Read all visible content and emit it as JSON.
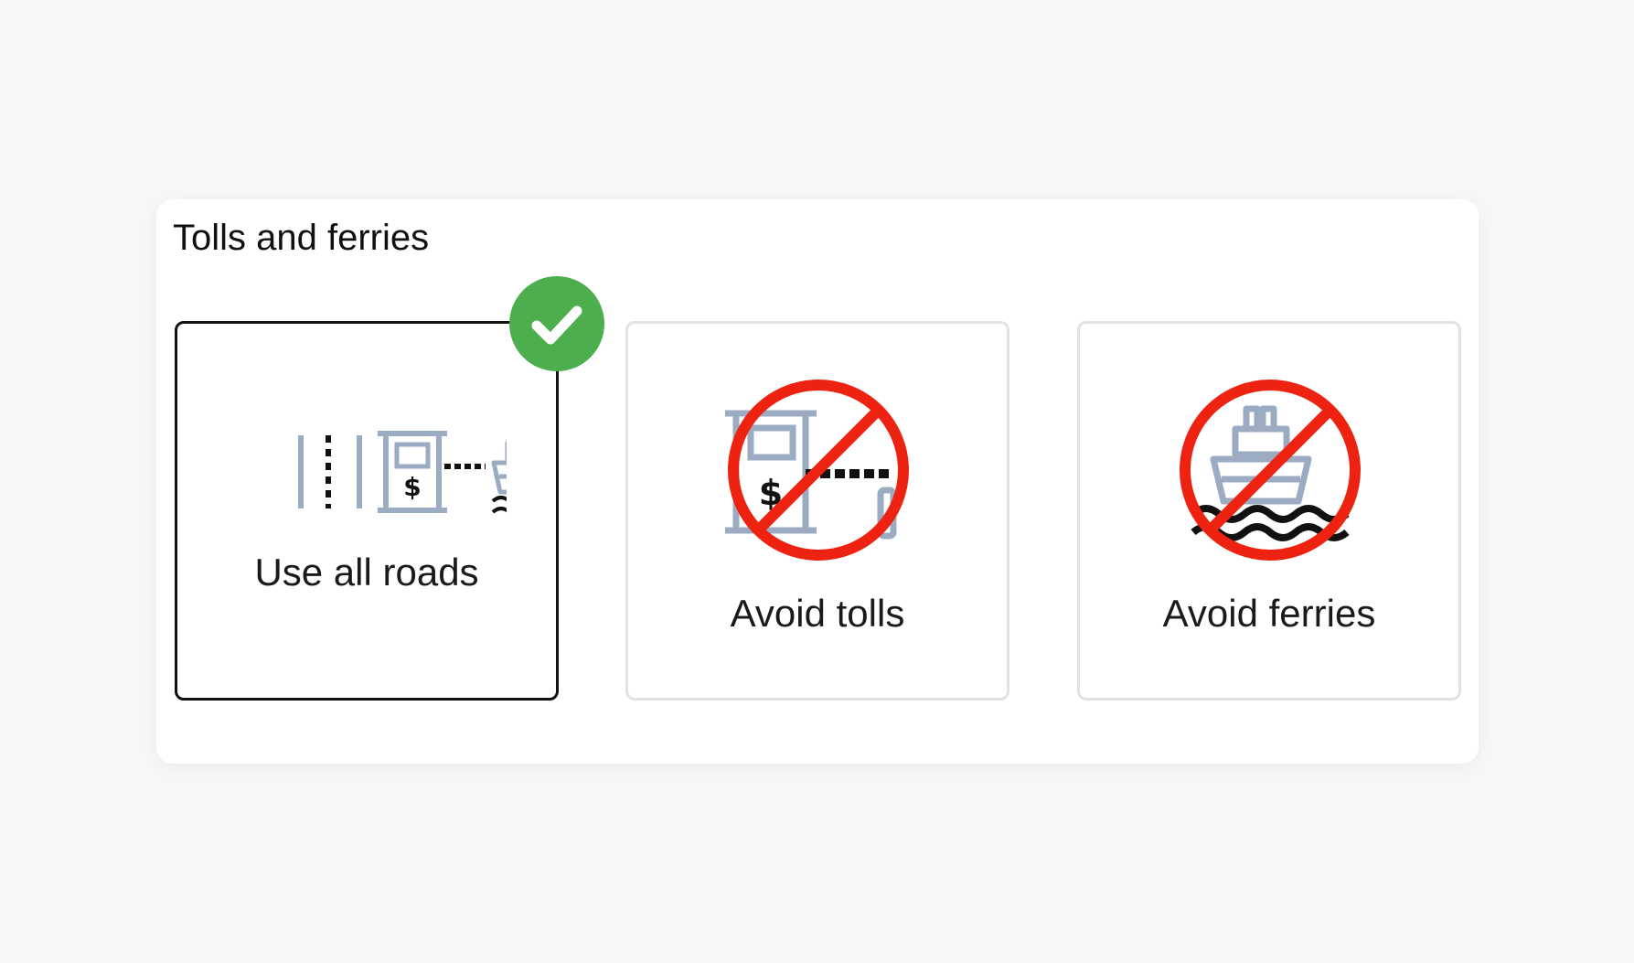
{
  "section": {
    "title": "Tolls and ferries"
  },
  "options": [
    {
      "label": "Use all roads",
      "selected": true,
      "icon": "all-roads-icon"
    },
    {
      "label": "Avoid tolls",
      "selected": false,
      "icon": "no-tolls-icon"
    },
    {
      "label": "Avoid ferries",
      "selected": false,
      "icon": "no-ferries-icon"
    }
  ],
  "selection_badge": {
    "icon": "checkmark-icon"
  },
  "colors": {
    "page_background": "#f8f8f8",
    "card_background": "#ffffff",
    "selected_border": "#111111",
    "unselected_border": "#e2e2e2",
    "icon_gray": "#9aabc2",
    "prohibit_red": "#ee2211",
    "check_green": "#4cae4c"
  }
}
